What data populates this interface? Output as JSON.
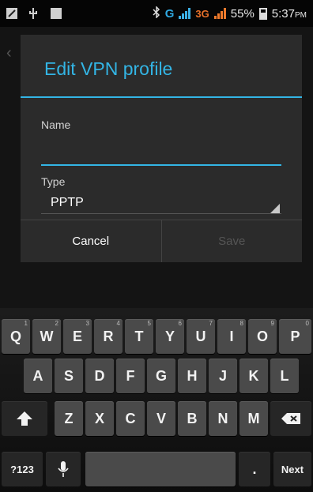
{
  "status_bar": {
    "network_g": "G",
    "network_3g": "3G",
    "battery_percent": "55%",
    "time": "5:37",
    "ampm": "PM",
    "icons": [
      "notification-icon",
      "usb-icon",
      "image-icon",
      "bluetooth-icon",
      "signal-icon",
      "battery-icon"
    ]
  },
  "dialog": {
    "title": "Edit VPN profile",
    "name_label": "Name",
    "name_value": "",
    "type_label": "Type",
    "type_value": "PPTP",
    "cancel_label": "Cancel",
    "save_label": "Save",
    "accent_color": "#33b5e5"
  },
  "keyboard": {
    "row1": [
      {
        "label": "Q",
        "hint": "1"
      },
      {
        "label": "W",
        "hint": "2"
      },
      {
        "label": "E",
        "hint": "3"
      },
      {
        "label": "R",
        "hint": "4"
      },
      {
        "label": "T",
        "hint": "5"
      },
      {
        "label": "Y",
        "hint": "6"
      },
      {
        "label": "U",
        "hint": "7"
      },
      {
        "label": "I",
        "hint": "8"
      },
      {
        "label": "O",
        "hint": "9"
      },
      {
        "label": "P",
        "hint": "0"
      }
    ],
    "row2": [
      "A",
      "S",
      "D",
      "F",
      "G",
      "H",
      "J",
      "K",
      "L"
    ],
    "row3": [
      "Z",
      "X",
      "C",
      "V",
      "B",
      "N",
      "M"
    ],
    "symbols_label": "?123",
    "period_label": ".",
    "next_label": "Next",
    "shift_icon": "shift-arrow-icon",
    "backspace_icon": "backspace-icon",
    "mic_icon": "microphone-icon"
  }
}
